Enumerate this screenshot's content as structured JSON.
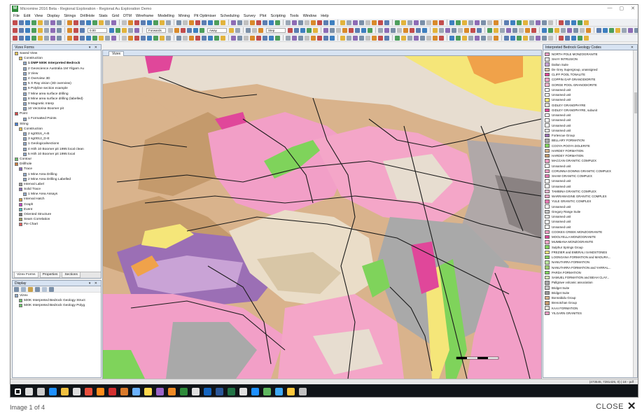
{
  "window": {
    "app_icon": "M",
    "title": "Micromine 2016 Beta - Regional Exploration - Regional Au Exploration Demo",
    "controls": [
      "—",
      "▢",
      "✕"
    ]
  },
  "menu": [
    "File",
    "Edit",
    "View",
    "Display",
    "Strings",
    "DrillHole",
    "Stats",
    "Grid",
    "DTM",
    "Wireframe",
    "Modelling",
    "Mining",
    "Pit Optimiser",
    "Scheduling",
    "Survey",
    "Plot",
    "Scripting",
    "Tools",
    "Window",
    "Help"
  ],
  "toolbar": {
    "zoom_value": "0.00",
    "combo_1": "Forwards",
    "combo_2": "Away",
    "combo_3": "Step"
  },
  "vizex_forms": {
    "title": "Vizex Forms",
    "items": [
      {
        "label": "Saved View",
        "indent": 0,
        "icon": "folder-icon"
      },
      {
        "label": "Construction",
        "indent": 1,
        "icon": "folder-icon"
      },
      {
        "label": "1 DMP 500K Interpreted Bedrock",
        "indent": 2,
        "icon": "view-icon",
        "bold": true
      },
      {
        "label": "2 Geoscience Australia 1M Yilgarn Au",
        "indent": 2,
        "icon": "view-icon"
      },
      {
        "label": "3 View",
        "indent": 2,
        "icon": "view-icon"
      },
      {
        "label": "4 Overview 3D",
        "indent": 2,
        "icon": "view-icon"
      },
      {
        "label": "5 X-Ray vision (3D overview)",
        "indent": 2,
        "icon": "view-icon"
      },
      {
        "label": "6 Polyline section example",
        "indent": 2,
        "icon": "view-icon"
      },
      {
        "label": "7 Mine area surface drilling",
        "indent": 2,
        "icon": "view-icon"
      },
      {
        "label": "8 Mine area surface drilling (labelled)",
        "indent": 2,
        "icon": "view-icon"
      },
      {
        "label": "9 Magnetic Interp",
        "indent": 2,
        "icon": "view-icon"
      },
      {
        "label": "10 Vectorise Boomer pit",
        "indent": 2,
        "icon": "view-icon"
      },
      {
        "label": "Point",
        "indent": 0,
        "icon": "point-icon"
      },
      {
        "label": "1 Formatted Points",
        "indent": 2,
        "icon": "view-icon"
      },
      {
        "label": "String",
        "indent": 0,
        "icon": "string-icon"
      },
      {
        "label": "Construction",
        "indent": 1,
        "icon": "folder-icon"
      },
      {
        "label": "2 sg0016_A-B",
        "indent": 2,
        "icon": "view-icon"
      },
      {
        "label": "3 sg0012_D-E",
        "indent": 2,
        "icon": "view-icon"
      },
      {
        "label": "1 Geologicalsections",
        "indent": 2,
        "icon": "view-icon"
      },
      {
        "label": "4 Hith 10 Boomer pit 1995 local clean",
        "indent": 2,
        "icon": "view-icon"
      },
      {
        "label": "5 Hith 10 Boomer pit 1995 local",
        "indent": 2,
        "icon": "view-icon"
      },
      {
        "label": "Contour",
        "indent": 0,
        "icon": "contour-icon"
      },
      {
        "label": "Drillhole",
        "indent": 0,
        "icon": "drillhole-icon"
      },
      {
        "label": "Trace",
        "indent": 1,
        "icon": "trace-icon"
      },
      {
        "label": "1 Mine Area Drilling",
        "indent": 2,
        "icon": "view-icon"
      },
      {
        "label": "2 Mine Area Drilling Labelled",
        "indent": 2,
        "icon": "view-icon"
      },
      {
        "label": "Interval Label",
        "indent": 1,
        "icon": "label-icon"
      },
      {
        "label": "Solid Trace",
        "indent": 1,
        "icon": "trace-icon"
      },
      {
        "label": "1 Mine Area Assays",
        "indent": 2,
        "icon": "view-icon"
      },
      {
        "label": "Interval Hatch",
        "indent": 1,
        "icon": "hatch-icon"
      },
      {
        "label": "Graph",
        "indent": 1,
        "icon": "graph-icon"
      },
      {
        "label": "Event",
        "indent": 1,
        "icon": "event-icon"
      },
      {
        "label": "Oriented Structure",
        "indent": 1,
        "icon": "structure-icon"
      },
      {
        "label": "Seam Correlation",
        "indent": 1,
        "icon": "seam-icon"
      },
      {
        "label": "Pie Chart",
        "indent": 1,
        "icon": "pie-icon"
      }
    ],
    "tabs": [
      "Vizex Forms",
      "Properties",
      "Sections"
    ]
  },
  "display": {
    "title": "Display",
    "items": [
      {
        "label": "Vizex",
        "indent": 0
      },
      {
        "label": "500K Interpreted Bedrock Geology Struct",
        "indent": 1
      },
      {
        "label": "500K Interpreted Bedrock Geology Polyg",
        "indent": 1
      }
    ]
  },
  "map": {
    "tab_label": "Vizex"
  },
  "legend": {
    "title": "Interpreted Bedrock Geology Codes",
    "colors": {
      "pink": "#f29fc7",
      "magenta": "#e0479a",
      "green": "#7fd35b",
      "yellow": "#f5e679",
      "orange": "#f0a24a",
      "tan": "#d9b38c",
      "grey": "#a9a9a9",
      "violet": "#9b6fb5",
      "white": "#ffffff"
    },
    "items": [
      {
        "label": "NORTH POLE MONZOGRANITE",
        "color": "#f29fc7"
      },
      {
        "label": "SHAY INTRUSION",
        "color": "#e3e3e3"
      },
      {
        "label": "Dalton Suite",
        "color": "#c9a3d6"
      },
      {
        "label": "De Grey Supergroup, unassigned",
        "color": "#d9c6a5"
      },
      {
        "label": "CLIFF POOL TONALITE",
        "color": "#e0479a"
      },
      {
        "label": "COPPIN GAP GRANODIORITE",
        "color": "#f4a6c8"
      },
      {
        "label": "GORGE POOL GRANODIORITE",
        "color": "#f7b5d0"
      },
      {
        "label": "Unnamed unit",
        "color": "#ffffff"
      },
      {
        "label": "Unnamed unit",
        "color": "#ffffff"
      },
      {
        "label": "Unnamed unit",
        "color": "#f5e679"
      },
      {
        "label": "GIDLEY GRANOPHYRE",
        "color": "#e5e1d8"
      },
      {
        "label": "GIDLEY GRANOPHYRE, subunit",
        "color": "#e0479a"
      },
      {
        "label": "Unnamed unit",
        "color": "#ffffff"
      },
      {
        "label": "Unnamed unit",
        "color": "#ffffff"
      },
      {
        "label": "Unnamed unit",
        "color": "#ffffff"
      },
      {
        "label": "Unnamed unit",
        "color": "#ffffff"
      },
      {
        "label": "Fortescue Group",
        "color": "#9b6fb5"
      },
      {
        "label": "BELLARY FORMATION",
        "color": "#a9a9a9"
      },
      {
        "label": "COOYA POOYA DOLERITE",
        "color": "#7fd35b"
      },
      {
        "label": "HARDEY FORMATION",
        "color": "#d9b38c"
      },
      {
        "label": "HARDEY FORMATION",
        "color": "#c49a6c"
      },
      {
        "label": "MACCAN GRANITIC COMPLEX",
        "color": "#f29fc7"
      },
      {
        "label": "Unnamed unit",
        "color": "#ffffff"
      },
      {
        "label": "CORUNNA DOWNS GRANITIC COMPLEX",
        "color": "#f29fc7"
      },
      {
        "label": "SHAW GRANITIC COMPLEX",
        "color": "#e778b3"
      },
      {
        "label": "Unnamed unit",
        "color": "#ffffff"
      },
      {
        "label": "Unnamed unit",
        "color": "#ffffff"
      },
      {
        "label": "TAMBINA GRANITIC COMPLEX",
        "color": "#f7b5d0"
      },
      {
        "label": "WARRAWAGINE GRANITIC COMPLEX",
        "color": "#f4a6c8"
      },
      {
        "label": "YULE GRANITIC COMPLEX",
        "color": "#e778b3"
      },
      {
        "label": "Unnamed unit",
        "color": "#ffffff"
      },
      {
        "label": "Gregory Range Suite",
        "color": "#c8c8c8"
      },
      {
        "label": "Unnamed unit",
        "color": "#ffffff"
      },
      {
        "label": "Unnamed unit",
        "color": "#ffffff"
      },
      {
        "label": "Unnamed unit",
        "color": "#ffffff"
      },
      {
        "label": "COOKES CREEK MONZOGRANITE",
        "color": "#f29fc7"
      },
      {
        "label": "MOOLYELLA MONZOGRANITE",
        "color": "#e0479a"
      },
      {
        "label": "MUMBANA MONZOGRANITE",
        "color": "#f4a6c8"
      },
      {
        "label": "Sulphur Springs Group",
        "color": "#7fd35b"
      },
      {
        "label": "FREZIER and EMERALI SANDSTONES",
        "color": "#f5e679"
      },
      {
        "label": "LOONGANA FORMATION and MADURA...",
        "color": "#7fd35b"
      },
      {
        "label": "NANUTARRA FORMATION",
        "color": "#b8e39a"
      },
      {
        "label": "NANUTARRA FORMATION and YARRAL...",
        "color": "#9acd6d"
      },
      {
        "label": "PARDA FORMATION",
        "color": "#7fd35b"
      },
      {
        "label": "SAMUEL FORMATION and BEAH CLAY...",
        "color": "#d4f0b0"
      },
      {
        "label": "Pallgrave volcanic association",
        "color": "#a9a9a9"
      },
      {
        "label": "Bridget Suite",
        "color": "#c8c8c8"
      },
      {
        "label": "Bridget Suite",
        "color": "#9b9b9b"
      },
      {
        "label": "Bonnabidu Group",
        "color": "#d9b38c"
      },
      {
        "label": "Brenotchan Group",
        "color": "#c49a6c"
      },
      {
        "label": "KAAI FORMATION",
        "color": "#e5e1d8"
      },
      {
        "label": "YILGARN GRANITES",
        "color": "#f29fc7"
      }
    ]
  },
  "statusbar": {
    "coords": "(473545, 7281425, 0) | 18 - pdf"
  },
  "taskbar": {
    "icons": [
      "windows-start-icon",
      "search-icon",
      "task-view-icon",
      "edge-icon",
      "file-explorer-icon",
      "store-icon",
      "chrome-icon",
      "firefox-icon",
      "acrobat-icon",
      "app-icon",
      "app-icon",
      "app-icon",
      "app-icon",
      "app-icon",
      "micromine-icon",
      "app-icon",
      "outlook-icon",
      "word-icon",
      "excel-icon",
      "app-icon",
      "ie-icon",
      "app-icon",
      "app-icon",
      "app-icon",
      "app-icon"
    ],
    "icon_colors": [
      "#ffffff",
      "#dddddd",
      "#cccccc",
      "#1e90ff",
      "#f0c040",
      "#dddddd",
      "#e94e3c",
      "#ff8c1a",
      "#d32f2f",
      "#d97a2b",
      "#6bb2ff",
      "#ffd84d",
      "#9c64c8",
      "#f08a24",
      "#2e8b3a",
      "#e0e0e0",
      "#1565c0",
      "#2b579a",
      "#217346",
      "#e0e0e0",
      "#1e90ff",
      "#5fb85f",
      "#3fa9f5",
      "#ffc83d",
      "#c0c0c0"
    ]
  },
  "viewer": {
    "page_info": "Image 1 of 4",
    "close_label": "CLOSE"
  }
}
